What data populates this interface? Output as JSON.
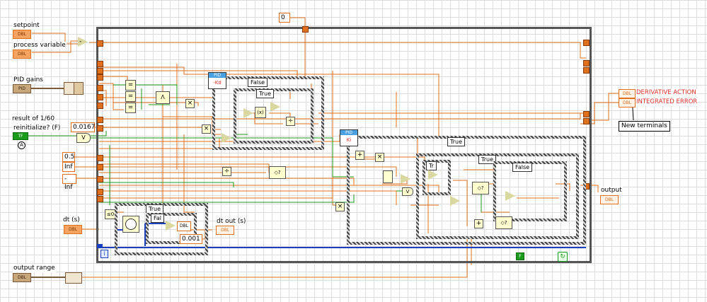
{
  "terminals": {
    "setpoint": {
      "label": "setpoint",
      "type": "DBL"
    },
    "process_variable": {
      "label": "process variable",
      "type": "DBL"
    },
    "pid_gains": {
      "label": "PID gains",
      "type": "PID"
    },
    "result": {
      "label": "result of 1/60"
    },
    "reinitialize": {
      "label": "reinitialize? (F)",
      "type": "TF"
    },
    "dt": {
      "label": "dt (s)",
      "type": "DBL"
    },
    "dt_out": {
      "label": "dt out (s)",
      "type": "DBL"
    },
    "output_range": {
      "label": "output range",
      "type": "DBL"
    },
    "output": {
      "label": "output",
      "type": "DBL"
    },
    "derivative_action": {
      "label": "DERIVATIVE ACTION",
      "type": "DBL"
    },
    "integrated_error": {
      "label": "INTEGRATED ERROR",
      "type": "DBL"
    }
  },
  "annotation": "New terminals",
  "constants": {
    "zero": "0",
    "c0167": "0.0167",
    "c05": "0.5",
    "inf": "Inf",
    "neginf": "-Inf",
    "c0001": "0.001"
  },
  "case_selectors": {
    "s1": "False",
    "s2": "True",
    "s3": "True",
    "s4": "True",
    "s5": "False",
    "s6": "Tr",
    "s7": "True",
    "s8": "Fal"
  },
  "subvi_labels": {
    "pid_deriv_title": "PID",
    "pid_deriv_body": "-Kd",
    "pid_int_title": "PID",
    "pid_int_body": "Ki",
    "dbl_convert": "DBL",
    "loop_i": "i"
  },
  "bool_constant": "F",
  "colors": {
    "float_wire": "#e0701c",
    "bool_wire": "#1b9a1b",
    "int_wire": "#1a3fbf",
    "cluster_wire": "#7a5a3a",
    "annotation_red": "#e0302a"
  }
}
